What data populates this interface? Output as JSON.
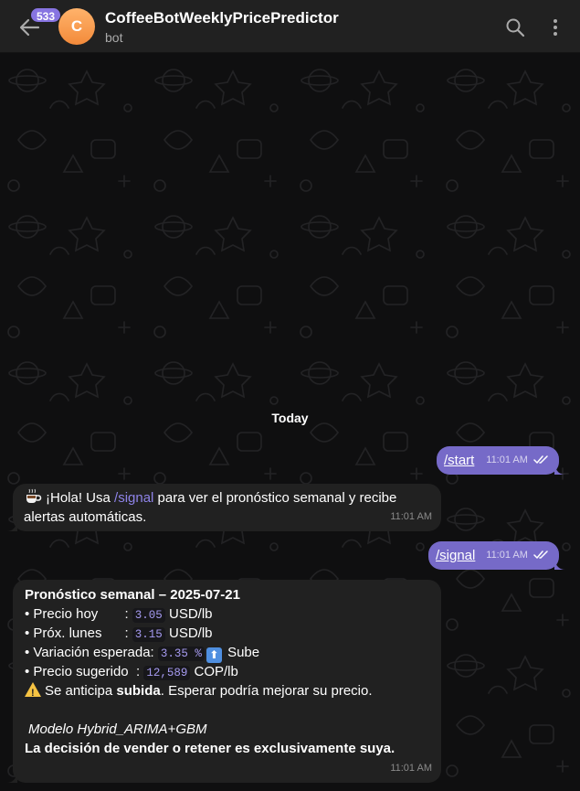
{
  "header": {
    "unread_count": "533",
    "avatar_letter": "C",
    "title": "CoffeeBotWeeklyPricePredictor",
    "subtitle": "bot"
  },
  "chat": {
    "date_separator": "Today",
    "messages": [
      {
        "direction": "out",
        "text": "/start",
        "time": "11:01 AM"
      },
      {
        "direction": "in",
        "line1_prefix": "¡Hola! Usa ",
        "command": "/signal",
        "line1_suffix": " para ver el pronóstico semanal y recibe",
        "line2": "alertas automáticas.",
        "time": "11:01 AM"
      },
      {
        "direction": "out",
        "text": "/signal",
        "time": "11:01 AM"
      },
      {
        "direction": "in",
        "title": "Pronóstico semanal – 2025-07-21",
        "rows": {
          "today_label": "• Precio hoy       : ",
          "today_value": "3.05",
          "today_unit": " USD/lb",
          "monday_label": "• Próx. lunes      : ",
          "monday_value": "3.15",
          "monday_unit": " USD/lb",
          "variation_label": "• Variación esperada: ",
          "variation_value": "3.35 %",
          "variation_arrow": "⬆",
          "variation_trend": " Sube",
          "suggested_label": "• Precio sugerido  : ",
          "suggested_value": "12,589",
          "suggested_unit": " COP/lb"
        },
        "warning_prefix": "Se anticipa ",
        "warning_bold": "subida",
        "warning_suffix": ". Esperar podría mejorar su precio.",
        "model": "Modelo Hybrid_ARIMA+GBM",
        "disclaimer": "La decisión de vender o retener es exclusivamente suya.",
        "time": "11:01 AM"
      }
    ]
  },
  "colors": {
    "header_bg": "#212121",
    "chat_bg": "#0f0f10",
    "outgoing_bubble": "#766ac8",
    "incoming_bubble": "#212121",
    "accent": "#8774e1",
    "avatar": "#f38a3a"
  },
  "icons": {
    "back": "arrow-left-icon",
    "search": "search-icon",
    "menu": "more-vertical-icon",
    "read_status": "double-check-icon",
    "coffee": "hot-beverage-emoji",
    "up_arrow": "up-arrow-emoji",
    "warning": "warning-emoji"
  }
}
